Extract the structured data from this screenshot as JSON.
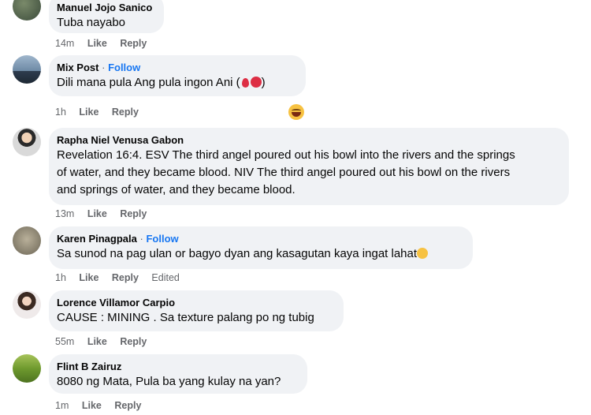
{
  "comments": [
    {
      "name": "Manuel Jojo Sanico",
      "follow": "",
      "text": "Tuba nayabo",
      "time": "14m",
      "like": "Like",
      "reply": "Reply",
      "edited": ""
    },
    {
      "name": "Mix Post",
      "follow": "Follow",
      "text": "Dili mana pula Ang pula ingon Ani (",
      "text_end": ")",
      "time": "1h",
      "like": "Like",
      "reply": "Reply",
      "edited": ""
    },
    {
      "name": "Rapha Niel Venusa Gabon",
      "follow": "",
      "text_lines": [
        "Revelation 16:4. ESV The third angel poured out his bowl into the rivers and the springs",
        "of water, and they became blood. NIV The third angel poured out his bowl on the rivers",
        "and springs of water, and they became blood."
      ],
      "time": "13m",
      "like": "Like",
      "reply": "Reply",
      "edited": ""
    },
    {
      "name": "Karen Pinagpala",
      "follow": "Follow",
      "text": "Sa sunod na pag ulan or bagyo dyan ang kasagutan kaya ingat lahat",
      "time": "1h",
      "like": "Like",
      "reply": "Reply",
      "edited": "Edited"
    },
    {
      "name": "Lorence Villamor Carpio",
      "follow": "",
      "text": "CAUSE : MINING . Sa texture palang po ng tubig",
      "time": "55m",
      "like": "Like",
      "reply": "Reply",
      "edited": ""
    },
    {
      "name": "Flint B Zairuz",
      "follow": "",
      "text": "8080 ng Mata, Pula ba yang kulay na yan?",
      "time": "1m",
      "like": "Like",
      "reply": "Reply",
      "edited": ""
    }
  ],
  "separator": "·",
  "colors": {
    "bubble": "#f0f2f5",
    "follow": "#1877f2",
    "meta": "#65676b"
  },
  "icons": {
    "reaction": "laughing-emoji-icon",
    "drop": "blood-drop-emoji-icon",
    "circle": "red-circle-emoji-icon",
    "sad": "sad-face-emoji-icon"
  }
}
